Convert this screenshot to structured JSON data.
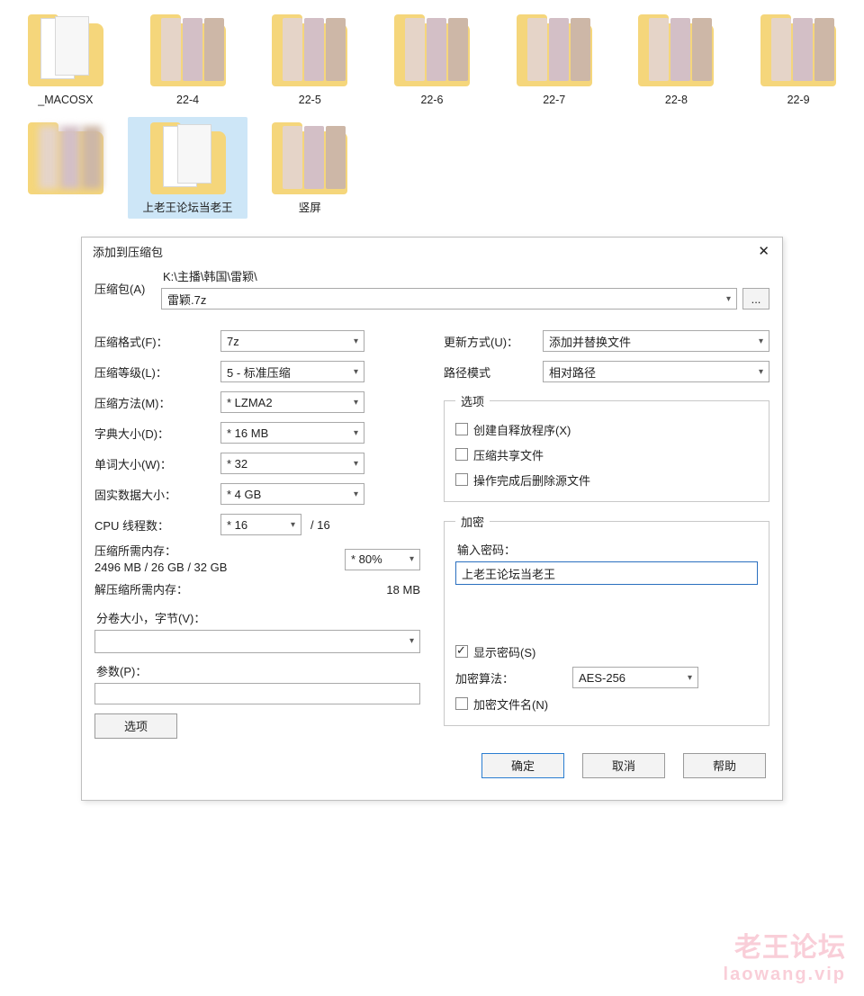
{
  "folders": [
    {
      "label": "_MACOSX",
      "kind": "docs"
    },
    {
      "label": "22-4",
      "kind": "thumbs"
    },
    {
      "label": "22-5",
      "kind": "thumbs"
    },
    {
      "label": "22-6",
      "kind": "thumbs"
    },
    {
      "label": "22-7",
      "kind": "thumbs"
    },
    {
      "label": "22-8",
      "kind": "thumbs"
    },
    {
      "label": "22-9",
      "kind": "thumbs"
    },
    {
      "label": "",
      "kind": "blur"
    },
    {
      "label": "上老王论坛当老王",
      "kind": "docs",
      "selected": true
    },
    {
      "label": "竖屏",
      "kind": "thumbs"
    }
  ],
  "dialog": {
    "title": "添加到压缩包",
    "archive_label": "压缩包(A)",
    "path": "K:\\主播\\韩国\\雷颖\\",
    "filename": "雷颖.7z",
    "browse": "...",
    "left": {
      "format_label": "压缩格式(F)：",
      "format_value": "7z",
      "level_label": "压缩等级(L)：",
      "level_value": "5 - 标准压缩",
      "method_label": "压缩方法(M)：",
      "method_value": "* LZMA2",
      "dict_label": "字典大小(D)：",
      "dict_value": "* 16 MB",
      "word_label": "单词大小(W)：",
      "word_value": "* 32",
      "solid_label": "固实数据大小：",
      "solid_value": "* 4 GB",
      "threads_label": "CPU 线程数：",
      "threads_value": "* 16",
      "threads_total": "/ 16",
      "mem_pack_label": "压缩所需内存：",
      "mem_pack_value": "2496 MB / 26 GB / 32 GB",
      "mem_pack_pct": "* 80%",
      "mem_unpack_label": "解压缩所需内存：",
      "mem_unpack_value": "18 MB",
      "split_label": "分卷大小，字节(V)：",
      "params_label": "参数(P)：",
      "options_button": "选项"
    },
    "right": {
      "update_label": "更新方式(U)：",
      "update_value": "添加并替换文件",
      "pathmode_label": "路径模式",
      "pathmode_value": "相对路径",
      "options_legend": "选项",
      "opt_sfx": "创建自释放程序(X)",
      "opt_shared": "压缩共享文件",
      "opt_delete": "操作完成后删除源文件",
      "encrypt_legend": "加密",
      "pwd_label": "输入密码：",
      "pwd_value": "上老王论坛当老王",
      "show_pwd": "显示密码(S)",
      "algo_label": "加密算法：",
      "algo_value": "AES-256",
      "encrypt_names": "加密文件名(N)"
    },
    "buttons": {
      "ok": "确定",
      "cancel": "取消",
      "help": "帮助"
    }
  },
  "watermark": {
    "big": "老王论坛",
    "small": "laowang.vip"
  }
}
